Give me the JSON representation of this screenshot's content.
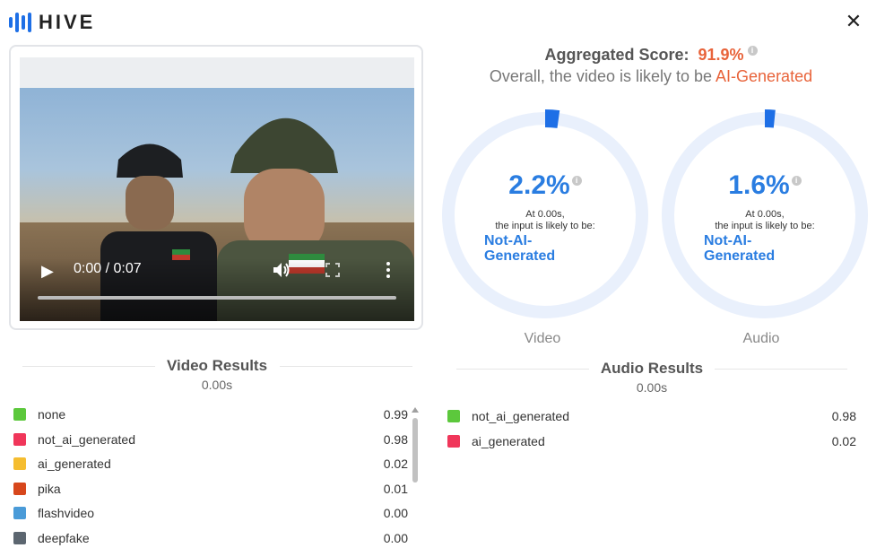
{
  "brand": {
    "name": "HIVE",
    "accent": "#1e6fe6"
  },
  "window": {
    "close_glyph": "✕"
  },
  "video_player": {
    "time": "0:00 / 0:07",
    "progress": 0.0
  },
  "aggregate": {
    "label": "Aggregated Score:",
    "score": "91.9%",
    "sentence": "Overall, the video is likely to be",
    "verdict": "AI-Generated",
    "verdict_color": "#e8633a"
  },
  "gauges": [
    {
      "name": "Video",
      "percent": "2.2%",
      "value": 0.022,
      "line1": "At 0.00s,",
      "line2": "the input is likely to be:",
      "label_line1": "Not-AI-",
      "label_line2": "Generated"
    },
    {
      "name": "Audio",
      "percent": "1.6%",
      "value": 0.016,
      "line1": "At 0.00s,",
      "line2": "the input is likely to be:",
      "label_line1": "Not-AI-",
      "label_line2": "Generated"
    }
  ],
  "video_results": {
    "title": "Video Results",
    "time": "0.00s",
    "rows": [
      {
        "label": "none",
        "value": "0.99",
        "color": "#5cc83c"
      },
      {
        "label": "not_ai_generated",
        "value": "0.98",
        "color": "#f0365a"
      },
      {
        "label": "ai_generated",
        "value": "0.02",
        "color": "#f5bd30"
      },
      {
        "label": "pika",
        "value": "0.01",
        "color": "#d7471c"
      },
      {
        "label": "flashvideo",
        "value": "0.00",
        "color": "#4a9bd8"
      },
      {
        "label": "deepfake",
        "value": "0.00",
        "color": "#5c6670"
      }
    ]
  },
  "audio_results": {
    "title": "Audio Results",
    "time": "0.00s",
    "rows": [
      {
        "label": "not_ai_generated",
        "value": "0.98",
        "color": "#5cc83c"
      },
      {
        "label": "ai_generated",
        "value": "0.02",
        "color": "#f0365a"
      }
    ]
  }
}
